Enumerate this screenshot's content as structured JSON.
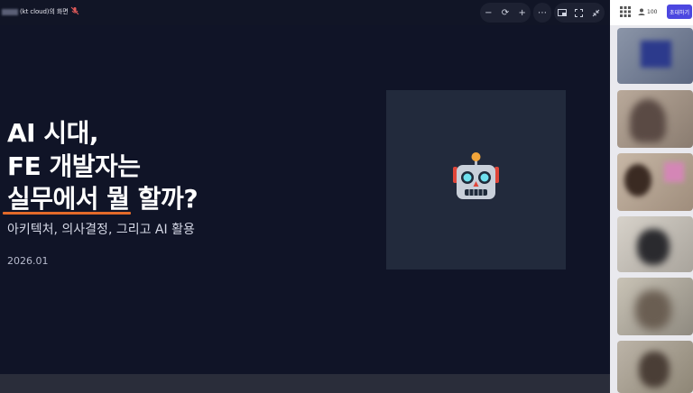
{
  "topbar": {
    "share_label": "(kt cloud)의 화면",
    "controls": [
      "zoom-out",
      "refresh",
      "zoom-in",
      "more",
      "pip",
      "fullscreen",
      "collapse"
    ]
  },
  "slide": {
    "title_line1": "AI 시대,",
    "title_line2": "FE 개발자는",
    "title_line3": "실무에서 뭘 할까?",
    "subtitle": "아키텍처, 의사결정, 그리고 AI 활용",
    "date": "2026.01",
    "accent_color": "#e36a2a",
    "image_icon": "robot-icon"
  },
  "right_panel": {
    "participant_count": "100",
    "invite_label": "초대하기"
  }
}
